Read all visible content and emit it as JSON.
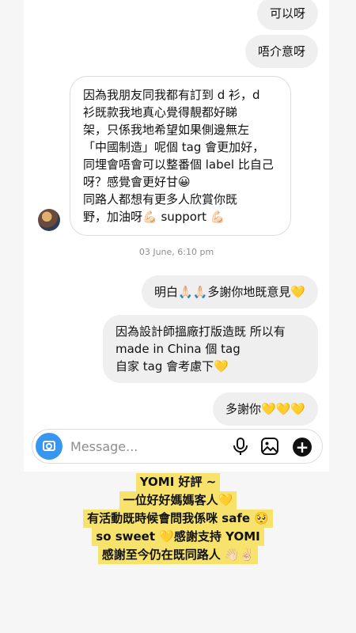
{
  "messages": {
    "out1": "可以呀",
    "out2": "唔介意呀",
    "in_line1": "因為我朋友同我都有訂到 d 衫，d",
    "in_line2": "衫既款我地真心覺得靚都好睇",
    "in_line3": "架，只係我地希望如果側邊無左",
    "in_line4": "「中國制造」呢個 tag 會更加好，",
    "in_line5": "同埋會唔會可以整番個 label 比自己",
    "in_line6": "呀？感覺會更好甘😀",
    "in_line7": "同路人都想有更多人欣賞你既",
    "in_line8": "野，加油呀💪🏻 support 💪🏻",
    "timestamp": "03 June, 6:10 pm",
    "out3": "明白🙏🏻🙏🏻多謝你地既意見💛",
    "out4_line1": "因為設計師搵廠打版造既 所以有",
    "out4_line2": "made in China 個 tag",
    "out4_line3": "自家 tag 會考慮下💛",
    "out5": "多謝你💛💛💛"
  },
  "composer": {
    "placeholder": "Message..."
  },
  "caption": {
    "line1": "YOMI 好評 ~",
    "line2": "一位好好媽媽客人💛",
    "line3": "有活動既時候會問我係咪 safe 🥺",
    "line4": "so sweet 💛感謝支持 YOMI",
    "line5": "感謝至今仍在既同路人 👋🏻✌🏻"
  },
  "colors": {
    "accent": "#3797f0",
    "highlight": "#f7e36b",
    "bubble_out": "#efefef"
  },
  "icons": [
    "camera-icon",
    "microphone-icon",
    "gallery-icon",
    "plus-icon"
  ]
}
